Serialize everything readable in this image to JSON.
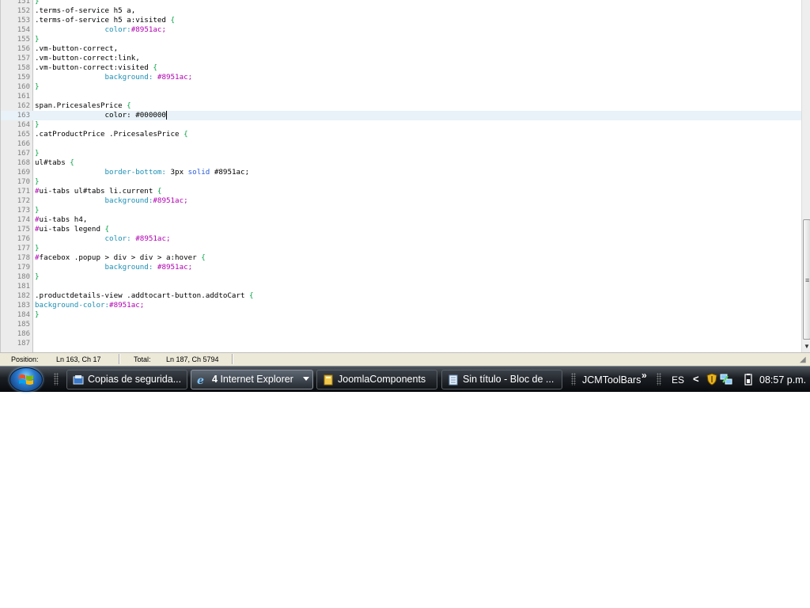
{
  "editor": {
    "lines": [
      {
        "num": "151",
        "segments": [
          {
            "t": "}",
            "c": "brace"
          }
        ]
      },
      {
        "num": "152",
        "segments": [
          {
            "t": ".terms-of-service h5 a,",
            "c": ""
          }
        ]
      },
      {
        "num": "153",
        "segments": [
          {
            "t": ".terms-of-service h5 a:visited ",
            "c": ""
          },
          {
            "t": "{",
            "c": "brace"
          }
        ]
      },
      {
        "num": "154",
        "segments": [
          {
            "t": "                ",
            "c": ""
          },
          {
            "t": "color:",
            "c": "prop"
          },
          {
            "t": "#8951ac;",
            "c": "sym"
          }
        ]
      },
      {
        "num": "155",
        "segments": [
          {
            "t": "}",
            "c": "brace"
          }
        ]
      },
      {
        "num": "156",
        "segments": [
          {
            "t": ".vm-button-correct,",
            "c": ""
          }
        ]
      },
      {
        "num": "157",
        "segments": [
          {
            "t": ".vm-button-correct:link,",
            "c": ""
          }
        ]
      },
      {
        "num": "158",
        "segments": [
          {
            "t": ".vm-button-correct:visited ",
            "c": ""
          },
          {
            "t": "{",
            "c": "brace"
          }
        ]
      },
      {
        "num": "159",
        "segments": [
          {
            "t": "                ",
            "c": ""
          },
          {
            "t": "background:",
            "c": "prop"
          },
          {
            "t": " #8951ac;",
            "c": "sym"
          }
        ]
      },
      {
        "num": "160",
        "segments": [
          {
            "t": "}",
            "c": "brace"
          }
        ]
      },
      {
        "num": "161",
        "segments": []
      },
      {
        "num": "162",
        "segments": [
          {
            "t": "span.PricesalesPrice ",
            "c": ""
          },
          {
            "t": "{",
            "c": "brace"
          }
        ]
      },
      {
        "num": "163",
        "current": true,
        "segments": [
          {
            "t": "                color: #000000",
            "c": ""
          }
        ]
      },
      {
        "num": "164",
        "segments": [
          {
            "t": "}",
            "c": "brace"
          }
        ]
      },
      {
        "num": "165",
        "segments": [
          {
            "t": ".catProductPrice .PricesalesPrice ",
            "c": ""
          },
          {
            "t": "{",
            "c": "brace"
          }
        ]
      },
      {
        "num": "166",
        "segments": []
      },
      {
        "num": "167",
        "segments": [
          {
            "t": "}",
            "c": "brace"
          }
        ]
      },
      {
        "num": "168",
        "segments": [
          {
            "t": "ul#tabs ",
            "c": ""
          },
          {
            "t": "{",
            "c": "brace"
          }
        ]
      },
      {
        "num": "169",
        "segments": [
          {
            "t": "                ",
            "c": ""
          },
          {
            "t": "border-bottom:",
            "c": "prop"
          },
          {
            "t": " 3px ",
            "c": ""
          },
          {
            "t": "solid",
            "c": "kw"
          },
          {
            "t": " #8951ac;",
            "c": ""
          }
        ]
      },
      {
        "num": "170",
        "segments": [
          {
            "t": "}",
            "c": "brace"
          }
        ]
      },
      {
        "num": "171",
        "segments": [
          {
            "t": "#",
            "c": "sym"
          },
          {
            "t": "ui-tabs ul#tabs li.current ",
            "c": ""
          },
          {
            "t": "{",
            "c": "brace"
          }
        ]
      },
      {
        "num": "172",
        "segments": [
          {
            "t": "                ",
            "c": ""
          },
          {
            "t": "background:",
            "c": "prop"
          },
          {
            "t": "#8951ac;",
            "c": "sym"
          }
        ]
      },
      {
        "num": "173",
        "segments": [
          {
            "t": "}",
            "c": "brace"
          }
        ]
      },
      {
        "num": "174",
        "segments": [
          {
            "t": "#",
            "c": "sym"
          },
          {
            "t": "ui-tabs h4,",
            "c": ""
          }
        ]
      },
      {
        "num": "175",
        "segments": [
          {
            "t": "#",
            "c": "sym"
          },
          {
            "t": "ui-tabs legend ",
            "c": ""
          },
          {
            "t": "{",
            "c": "brace"
          }
        ]
      },
      {
        "num": "176",
        "segments": [
          {
            "t": "                ",
            "c": ""
          },
          {
            "t": "color:",
            "c": "prop"
          },
          {
            "t": " #8951ac;",
            "c": "sym"
          }
        ]
      },
      {
        "num": "177",
        "segments": [
          {
            "t": "}",
            "c": "brace"
          }
        ]
      },
      {
        "num": "178",
        "segments": [
          {
            "t": "#",
            "c": "sym"
          },
          {
            "t": "facebox .popup > div > div > a:hover ",
            "c": ""
          },
          {
            "t": "{",
            "c": "brace"
          }
        ]
      },
      {
        "num": "179",
        "segments": [
          {
            "t": "                ",
            "c": ""
          },
          {
            "t": "background:",
            "c": "prop"
          },
          {
            "t": " #8951ac;",
            "c": "sym"
          }
        ]
      },
      {
        "num": "180",
        "segments": [
          {
            "t": "}",
            "c": "brace"
          }
        ]
      },
      {
        "num": "181",
        "segments": []
      },
      {
        "num": "182",
        "segments": [
          {
            "t": ".productdetails-view .addtocart-button.addtoCart ",
            "c": ""
          },
          {
            "t": "{",
            "c": "brace"
          }
        ]
      },
      {
        "num": "183",
        "segments": [
          {
            "t": "background-color:",
            "c": "prop"
          },
          {
            "t": "#8951ac;",
            "c": "sym"
          }
        ]
      },
      {
        "num": "184",
        "segments": [
          {
            "t": "}",
            "c": "brace"
          }
        ]
      },
      {
        "num": "185",
        "segments": []
      },
      {
        "num": "186",
        "segments": []
      },
      {
        "num": "187",
        "segments": []
      }
    ]
  },
  "statusbar": {
    "position_label": "Position:",
    "position_value": "Ln 163, Ch 17",
    "total_label": "Total:",
    "total_value": "Ln 187, Ch 5794"
  },
  "taskbar": {
    "tasks": [
      {
        "label": "Copias de segurida..."
      },
      {
        "count": "4",
        "label": "Internet Explorer"
      },
      {
        "label": "JoomlaComponents"
      },
      {
        "label": "Sin título - Bloc de ..."
      }
    ],
    "toolbar_label": "JCMToolBars",
    "toolbar_chevron": "»",
    "language": "ES",
    "tray_expand": "<",
    "clock": "08:57 p.m."
  },
  "colors": {
    "accent_purple": "#8951ac",
    "brace_green": "#0aa34a",
    "property_blue": "#1b8fb4"
  }
}
